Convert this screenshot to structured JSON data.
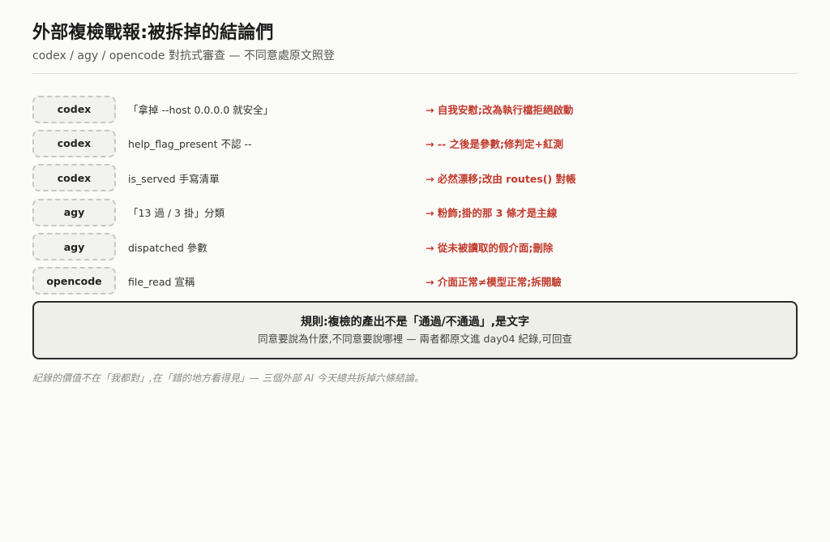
{
  "header": {
    "title": "外部複檢戰報:被拆掉的結論們",
    "subtitle": "codex / agy / opencode 對抗式審查 — 不同意處原文照登"
  },
  "rows": [
    {
      "reviewer": "codex",
      "claim": "「拿掉 --host 0.0.0.0 就安全」",
      "verdict": "→ 自我安慰;改為執行檔拒絕啟動"
    },
    {
      "reviewer": "codex",
      "claim": "help_flag_present 不認 --",
      "verdict": "→ -- 之後是參數;修判定+紅測"
    },
    {
      "reviewer": "codex",
      "claim": "is_served 手寫清單",
      "verdict": "→ 必然漂移;改由 routes() 對帳"
    },
    {
      "reviewer": "agy",
      "claim": "「13 過 / 3 掛」分類",
      "verdict": "→ 粉飾;掛的那 3 條才是主線"
    },
    {
      "reviewer": "agy",
      "claim": "dispatched 參數",
      "verdict": "→ 從未被讀取的假介面;刪除"
    },
    {
      "reviewer": "opencode",
      "claim": "file_read 宣稱",
      "verdict": "→ 介面正常≠模型正常;拆開驗"
    }
  ],
  "rule": {
    "title": "規則:複檢的產出不是「通過/不通過」,是文字",
    "text": "同意要說為什麼,不同意要說哪裡 — 兩者都原文進 day04 紀錄,可回查"
  },
  "footnote": "紀錄的價值不在「我都對」,在「錯的地方看得見」— 三個外部 AI 今天總共拆掉六條結論。",
  "colors": {
    "verdict": "#c0392b",
    "background": "#fbfbf8",
    "rule_border": "#2b2b2b"
  }
}
